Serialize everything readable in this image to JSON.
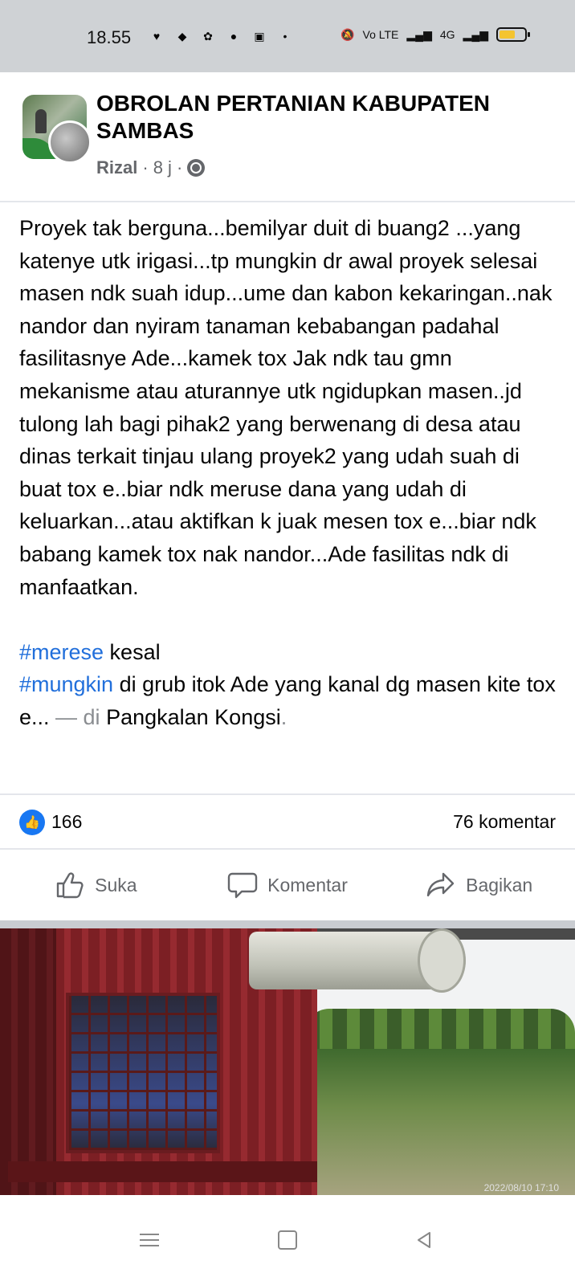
{
  "status_bar": {
    "time": "18.55",
    "left_icons": [
      "heart-icon",
      "app-icon",
      "fan-icon",
      "circle-app-icon",
      "message-icon",
      "dot-icon"
    ],
    "network_label": "Vo LTE",
    "network_type": "4G",
    "battery_color": "#f4c430"
  },
  "post": {
    "group_name": "OBROLAN PERTANIAN KABUPATEN SAMBAS",
    "author": "Rizal",
    "separator": "·",
    "time_ago": "8 j",
    "body": "Proyek tak berguna...bemilyar duit di buang2 ...yang katenye utk irigasi...tp mungkin dr awal proyek selesai masen ndk suah idup...ume dan kabon kekaringan..nak nandor dan nyiram tanaman kebabangan padahal fasilitasnye Ade...kamek tox Jak ndk tau gmn mekanisme atau aturannye utk ngidupkan masen..jd tulong lah bagi pihak2 yang berwenang di desa atau dinas terkait tinjau ulang proyek2 yang udah suah di buat tox e..biar ndk meruse dana yang udah di keluarkan...atau aktifkan k juak mesen tox e...biar ndk babang kamek tox nak nandor...Ade fasilitas ndk di manfaatkan.",
    "hashtag1": "#merese",
    "hashtag1_after": " kesal",
    "hashtag2": "#mungkin",
    "hashtag2_after": " di grub itok Ade yang kanal dg masen kite tox e...",
    "location_prefix": " — di ",
    "location": "Pangkalan Kongsi",
    "location_suffix": "."
  },
  "stats": {
    "like_count": "166",
    "comment_count": "76 komentar"
  },
  "actions": {
    "like": "Suka",
    "comment": "Komentar",
    "share": "Bagikan"
  },
  "photo": {
    "timestamp": "2022/08/10 17:10"
  },
  "colors": {
    "accent": "#1877f2",
    "hashtag": "#216fdb",
    "muted": "#65676b"
  }
}
